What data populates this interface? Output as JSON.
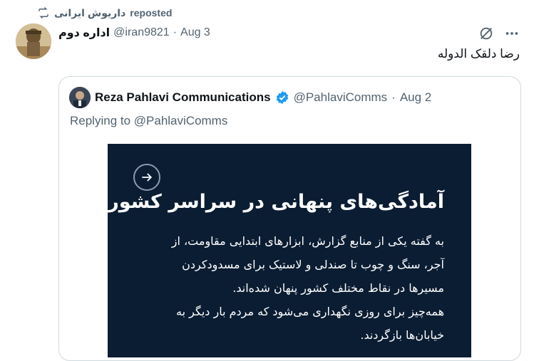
{
  "repost": {
    "user": "داریوش ایرانی",
    "label": "reposted"
  },
  "tweet": {
    "display_name": "اداره دوم",
    "handle": "@iran9821",
    "separator": "·",
    "date": "Aug 3",
    "text": "رضا دلقک الدوله"
  },
  "quote": {
    "display_name": "Reza Pahlavi Communications",
    "handle": "@PahlaviComms",
    "separator": "·",
    "date": "Aug 2",
    "replying": "Replying to @PahlaviComms",
    "media": {
      "title": "آمادگی‌های پنهانی در سراسر کشور",
      "lines": [
        "به گفته یکی از منابع گزارش، ابزارهای ابتدایی مقاومت، از",
        "آجر، سنگ و چوب تا صندلی و لاستیک برای مسدودکردن",
        "مسیرها در نقاط مختلف کشور پنهان شده‌اند.",
        "همه‌چیز برای روزی نگهداری می‌شود که مردم بار دیگر به",
        "خیابان‌ها بازگردند."
      ]
    }
  },
  "colors": {
    "text_primary": "#0f1419",
    "text_secondary": "#536471",
    "verified": "#1d9bf0",
    "media_bg": "#0b1d33"
  },
  "icons": [
    "repost-icon",
    "grok-icon",
    "more-icon",
    "verified-badge-icon",
    "arrow-right-icon"
  ]
}
